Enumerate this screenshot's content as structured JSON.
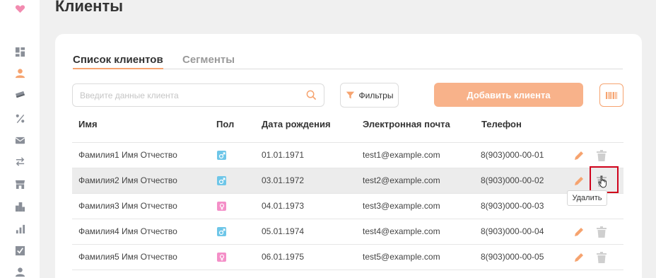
{
  "page": {
    "title": "Клиенты"
  },
  "colors": {
    "accent": "#f6a36f",
    "add_button": "#f8b28a",
    "male": "#6ec6e8",
    "female": "#f48fc8",
    "highlight": "#d0021b"
  },
  "sidebar": {
    "items": [
      {
        "icon": "heart-logo-icon"
      },
      {
        "icon": "dashboard-icon"
      },
      {
        "icon": "user-icon",
        "active": true
      },
      {
        "icon": "card-icon"
      },
      {
        "icon": "percent-icon"
      },
      {
        "icon": "mail-icon"
      },
      {
        "icon": "exchange-icon"
      },
      {
        "icon": "store-icon"
      },
      {
        "icon": "buildings-icon"
      },
      {
        "icon": "bar-chart-icon"
      },
      {
        "icon": "checklist-icon"
      },
      {
        "icon": "person-icon"
      }
    ]
  },
  "tabs": [
    {
      "label": "Список клиентов",
      "active": true
    },
    {
      "label": "Сегменты",
      "active": false
    }
  ],
  "toolbar": {
    "search_placeholder": "Введите данные клиента",
    "filter_label": "Фильтры",
    "add_label": "Добавить клиента"
  },
  "table": {
    "headers": {
      "name": "Имя",
      "gender": "Пол",
      "birth": "Дата рождения",
      "email": "Электронная почта",
      "phone": "Телефон"
    },
    "rows": [
      {
        "name": "Фамилия1 Имя Отчество",
        "gender": "male",
        "birth": "01.01.1971",
        "email": "test1@example.com",
        "phone": "8(903)000-00-01"
      },
      {
        "name": "Фамилия2 Имя Отчество",
        "gender": "male",
        "birth": "03.01.1972",
        "email": "test2@example.com",
        "phone": "8(903)000-00-02"
      },
      {
        "name": "Фамилия3 Имя Отчество",
        "gender": "female",
        "birth": "04.01.1973",
        "email": "test3@example.com",
        "phone": "8(903)000-00-03"
      },
      {
        "name": "Фамилия4 Имя Отчество",
        "gender": "male",
        "birth": "05.01.1974",
        "email": "test4@example.com",
        "phone": "8(903)000-00-04"
      },
      {
        "name": "Фамилия5 Имя Отчество",
        "gender": "female",
        "birth": "06.01.1975",
        "email": "test5@example.com",
        "phone": "8(903)000-00-05"
      }
    ]
  },
  "tooltip": {
    "text": "Удалить"
  }
}
